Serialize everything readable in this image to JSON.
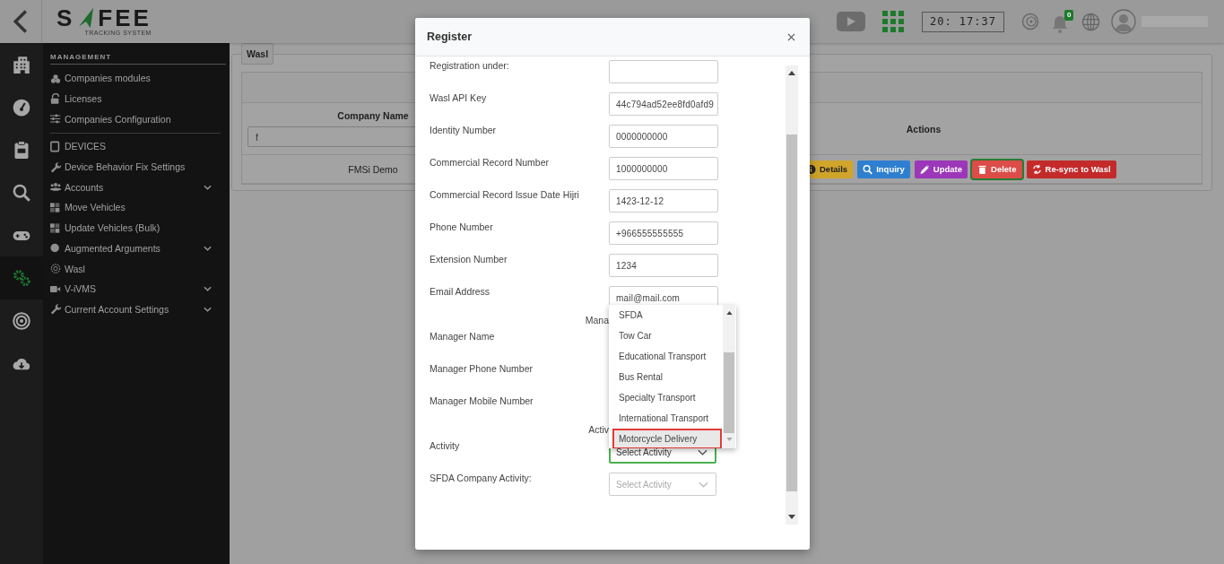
{
  "topbar": {
    "logo_left": "S",
    "logo_right": "FEE",
    "logo_tagline": "TRACKING SYSTEM",
    "clock": "20: 17:37",
    "notification_count": "0"
  },
  "rail": [
    {
      "selected": false
    },
    {
      "selected": false
    },
    {
      "selected": false
    },
    {
      "selected": false
    },
    {
      "selected": false
    },
    {
      "selected": true
    },
    {
      "selected": false
    },
    {
      "selected": false
    }
  ],
  "menu": {
    "sections": [
      {
        "header": "MANAGEMENT",
        "items": [
          {
            "label": "Companies modules",
            "expandable": false
          },
          {
            "label": "Licenses",
            "expandable": false
          },
          {
            "label": "Companies Configuration",
            "expandable": false
          }
        ]
      },
      {
        "items": [
          {
            "label": "DEVICES",
            "expandable": false
          },
          {
            "label": "Device Behavior Fix Settings",
            "expandable": false
          },
          {
            "label": "Accounts",
            "expandable": true
          },
          {
            "label": "Move Vehicles",
            "expandable": false
          },
          {
            "label": "Update Vehicles (Bulk)",
            "expandable": false
          },
          {
            "label": "Augmented Arguments",
            "expandable": true
          },
          {
            "label": "Wasl",
            "expandable": false
          },
          {
            "label": "V-iVMS",
            "expandable": true
          },
          {
            "label": "Current Account Settings",
            "expandable": true
          }
        ]
      }
    ]
  },
  "panel": {
    "title": "Wasl",
    "table": {
      "columns": [
        {
          "label": "Company Name",
          "filter": "f"
        },
        {
          "label": "Actions"
        }
      ],
      "rows": [
        {
          "company": "FMSi Demo",
          "actions": [
            {
              "kind": "details",
              "label": "Details",
              "color": "#d1a52a",
              "focused": false
            },
            {
              "kind": "inquiry",
              "label": "Inquiry",
              "color": "#2e7fd0",
              "focused": false
            },
            {
              "kind": "update",
              "label": "Update",
              "color": "#9b37b8",
              "focused": false
            },
            {
              "kind": "delete",
              "label": "Delete",
              "color": "#dc4c48",
              "focused": true
            },
            {
              "kind": "resync",
              "label": "Re-sync to Wasl",
              "color": "#c42a2a",
              "focused": false
            }
          ]
        }
      ]
    }
  },
  "modal": {
    "title": "Register",
    "fields": [
      {
        "kind": "input",
        "label": "Registration under:"
      },
      {
        "kind": "input",
        "label": "Wasl API Key",
        "value": "44c794ad52ee8fd0afd9"
      },
      {
        "kind": "input",
        "label": "Identity Number",
        "value": "0000000000"
      },
      {
        "kind": "input",
        "label": "Commercial Record Number",
        "value": "1000000000"
      },
      {
        "kind": "input",
        "label": "Commercial Record Issue Date Hijri",
        "value": "1423-12-12"
      },
      {
        "kind": "input",
        "label": "Phone Number",
        "value": "+966555555555"
      },
      {
        "kind": "input",
        "label": "Extension Number",
        "value": "1234"
      },
      {
        "kind": "input",
        "label": "Email Address",
        "value": "mail@mail.com"
      },
      {
        "kind": "heading",
        "text": "Mana"
      },
      {
        "kind": "label",
        "label": "Manager Name"
      },
      {
        "kind": "label",
        "label": "Manager Phone Number"
      },
      {
        "kind": "label",
        "label": "Manager Mobile Number"
      },
      {
        "kind": "heading",
        "text": "Activ"
      },
      {
        "kind": "select",
        "label": "Activity",
        "placeholder": "Select Activity",
        "focused": true,
        "disabled": false
      },
      {
        "kind": "select",
        "label": "SFDA Company Activity:",
        "placeholder": "Select Activity",
        "focused": false,
        "disabled": true
      }
    ],
    "dropdown": {
      "options": [
        {
          "label": "SFDA",
          "selected": false
        },
        {
          "label": "Tow Car",
          "selected": false
        },
        {
          "label": "Educational Transport",
          "selected": false
        },
        {
          "label": "Bus Rental",
          "selected": false
        },
        {
          "label": "Specialty Transport",
          "selected": false
        },
        {
          "label": "International Transport",
          "selected": false
        },
        {
          "label": "Motorcycle Delivery",
          "selected": true
        }
      ]
    }
  }
}
